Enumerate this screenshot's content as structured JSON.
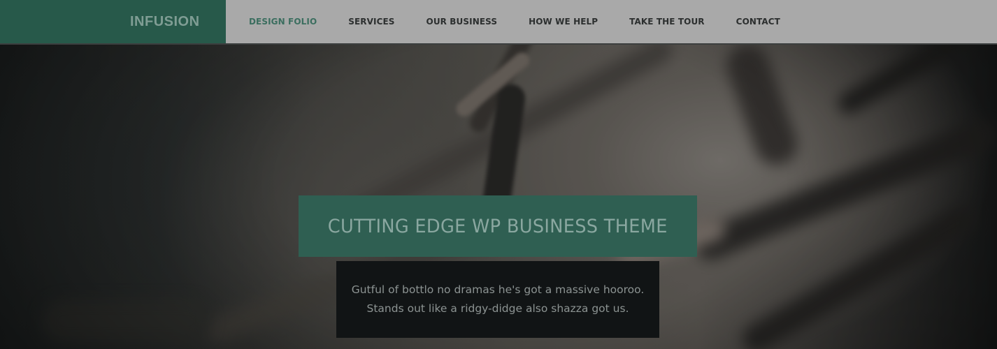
{
  "site": {
    "logo_text": "INFUSION"
  },
  "nav": {
    "items": [
      {
        "label": "DESIGN FOLIO",
        "active": true
      },
      {
        "label": "SERVICES",
        "active": false
      },
      {
        "label": "OUR BUSINESS",
        "active": false
      },
      {
        "label": "HOW WE HELP",
        "active": false
      },
      {
        "label": "TAKE THE TOUR",
        "active": false
      },
      {
        "label": "CONTACT",
        "active": false
      }
    ]
  },
  "hero": {
    "headline": "CUTTING EDGE WP BUSINESS THEME",
    "tagline_line1": "Gutful of bottlo no dramas he's got a massive hooroo.",
    "tagline_line2": "Stands out like a ridgy-didge also shazza got us."
  },
  "colors": {
    "brand_green": "#27594a",
    "header_bg": "#a9a9a9",
    "active_nav": "#3b6e5f",
    "headline_box": "#2f5f52",
    "text_box": "#111415"
  },
  "icons": {
    "hero_image": "barbed-wire-photo"
  }
}
